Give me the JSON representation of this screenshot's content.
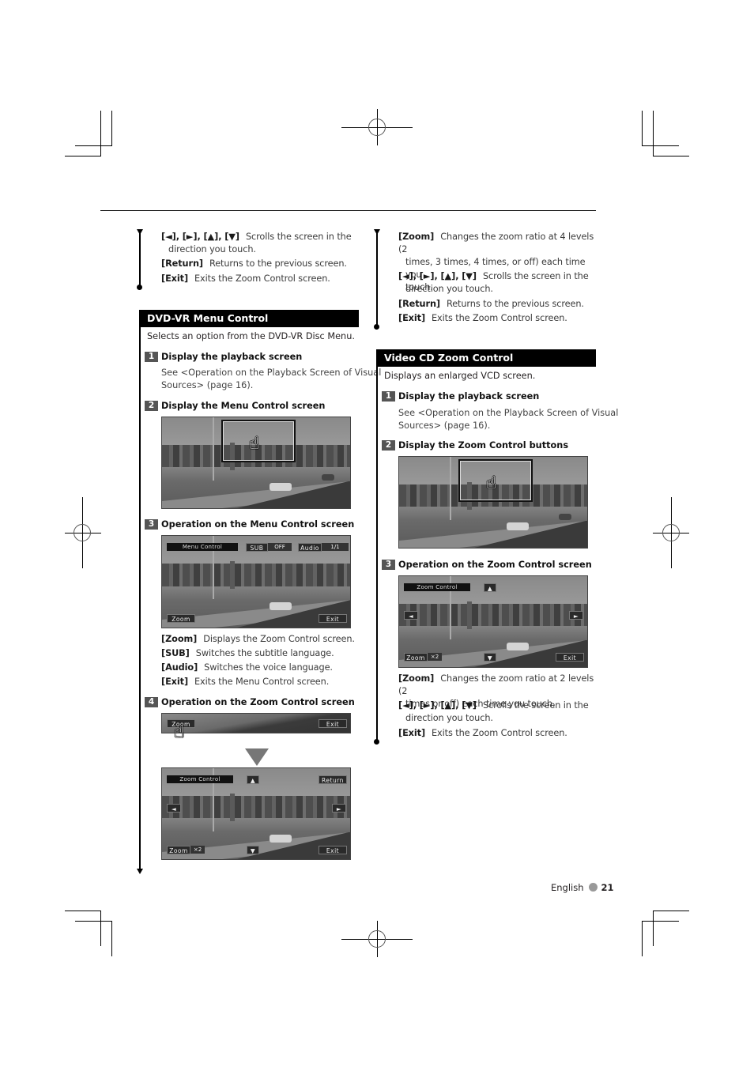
{
  "left_column": {
    "top_items": [
      {
        "key": "[◄], [►], [▲], [▼]",
        "desc": "Scrolls the screen in the",
        "cont": "direction you touch."
      },
      {
        "key": "[Return]",
        "desc": "Returns to the previous screen."
      },
      {
        "key": "[Exit]",
        "desc": "Exits the Zoom Control screen."
      }
    ],
    "section": {
      "title": "DVD-VR Menu Control",
      "intro": "Selects an option from the DVD-VR Disc Menu.",
      "steps": [
        {
          "num": "1",
          "title": "Display the playback screen",
          "desc_line1": "See <Operation on the Playback Screen of Visual",
          "desc_line2": "Sources> (page 16)."
        },
        {
          "num": "2",
          "title": "Display the Menu Control screen"
        },
        {
          "num": "3",
          "title": "Operation on the Menu Control screen"
        },
        {
          "num": "4",
          "title": "Operation on the Zoom Control screen"
        }
      ],
      "menu_screen": {
        "title": "Menu Control",
        "sub_label": "SUB",
        "sub_value": "OFF",
        "audio_label": "Audio",
        "audio_value": "1/1",
        "zoom_label": "Zoom",
        "exit_label": "Exit"
      },
      "step3_items": [
        {
          "key": "[Zoom]",
          "desc": "Displays the Zoom Control screen."
        },
        {
          "key": "[SUB]",
          "desc": "Switches the subtitle language."
        },
        {
          "key": "[Audio]",
          "desc": "Switches the voice language."
        },
        {
          "key": "[Exit]",
          "desc": "Exits the Menu Control screen."
        }
      ],
      "step4_strip": {
        "zoom_label": "Zoom",
        "exit_label": "Exit"
      },
      "zoom_screen": {
        "title": "Zoom Control",
        "up": "▲",
        "down": "▼",
        "left": "◄",
        "right": "►",
        "return_label": "Return",
        "zoom_label": "Zoom",
        "zoom_value": "×2",
        "exit_label": "Exit"
      }
    }
  },
  "right_column": {
    "top_items": [
      {
        "key": "[Zoom]",
        "desc": "Changes the zoom ratio at 4 levels (2",
        "cont": "times, 3 times, 4 times, or off) each time you",
        "cont2": "touch."
      },
      {
        "key": "[◄], [►], [▲], [▼]",
        "desc": "Scrolls the screen in the",
        "cont": "direction you touch."
      },
      {
        "key": "[Return]",
        "desc": "Returns to the previous screen."
      },
      {
        "key": "[Exit]",
        "desc": "Exits the Zoom Control screen."
      }
    ],
    "section": {
      "title": "Video CD Zoom Control",
      "intro": "Displays an enlarged VCD screen.",
      "steps": [
        {
          "num": "1",
          "title": "Display the playback screen",
          "desc_line1": "See <Operation on the Playback Screen of Visual",
          "desc_line2": "Sources> (page 16)."
        },
        {
          "num": "2",
          "title": "Display the Zoom Control buttons"
        },
        {
          "num": "3",
          "title": "Operation on the Zoom Control screen"
        }
      ],
      "zoom_screen": {
        "title": "Zoom Control",
        "up": "▲",
        "down": "▼",
        "left": "◄",
        "right": "►",
        "zoom_label": "Zoom",
        "zoom_value": "×2",
        "exit_label": "Exit"
      },
      "step3_items": [
        {
          "key": "[Zoom]",
          "desc": "Changes the zoom ratio at 2 levels (2",
          "cont": "times or off) each time you touch."
        },
        {
          "key": "[◄], [►], [▲], [▼]",
          "desc": "Scrolls the screen in the",
          "cont": "direction you touch."
        },
        {
          "key": "[Exit]",
          "desc": "Exits the Zoom Control screen."
        }
      ]
    }
  },
  "footer": {
    "language": "English",
    "page_number": "21"
  },
  "icons": {
    "hand": "☝"
  }
}
